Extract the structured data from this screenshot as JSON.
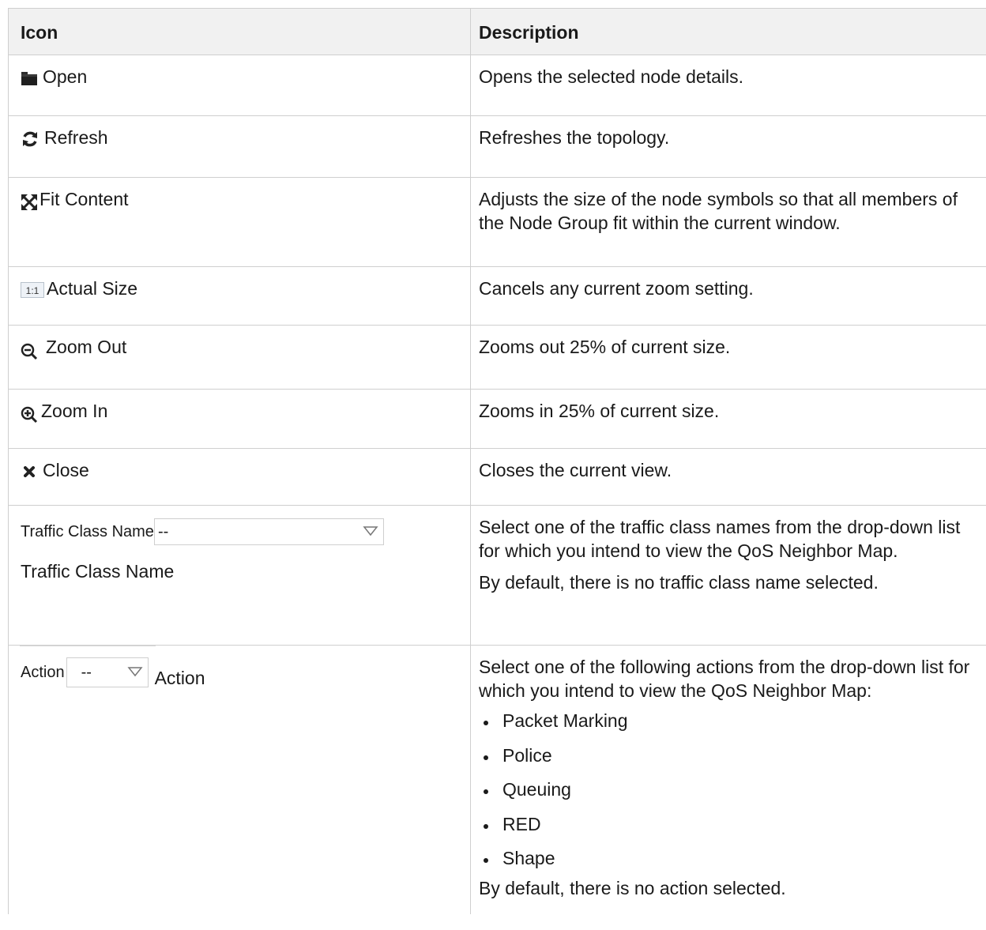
{
  "table": {
    "header": {
      "icon": "Icon",
      "description": "Description"
    },
    "rows": [
      {
        "label": "Open",
        "icon": "folder-icon",
        "description": "Opens the selected node details."
      },
      {
        "label": "Refresh",
        "icon": "refresh-icon",
        "description": "Refreshes the topology."
      },
      {
        "label": "Fit Content",
        "icon": "fit-content-icon",
        "description": "Adjusts the size of the node symbols so that all members of the Node Group fit within the current window."
      },
      {
        "label": "Actual Size",
        "icon": "actual-size-icon",
        "icon_text": "1:1",
        "description": "Cancels any current zoom setting."
      },
      {
        "label": "Zoom Out",
        "icon": "zoom-out-icon",
        "description": "Zooms out 25% of current size."
      },
      {
        "label": "Zoom In",
        "icon": "zoom-in-icon",
        "description": "Zooms in 25% of current size."
      },
      {
        "label": "Close",
        "icon": "close-icon",
        "description": "Closes the current view."
      }
    ],
    "traffic_class": {
      "combo_label": "Traffic Class Name",
      "combo_value": "--",
      "label": "Traffic Class Name",
      "description": "Select one of the traffic class names from the drop-down list for which you intend to view the QoS Neighbor Map.",
      "default_note": "By default, there is no traffic class name selected."
    },
    "action": {
      "combo_label": "Action",
      "combo_value": "--",
      "label": "Action",
      "description": "Select one of the following actions from the drop-down list for which you intend to view the QoS Neighbor Map:",
      "options": [
        "Packet Marking",
        "Police",
        "Queuing",
        "RED",
        "Shape"
      ],
      "default_note": "By default, there is no action selected."
    }
  }
}
